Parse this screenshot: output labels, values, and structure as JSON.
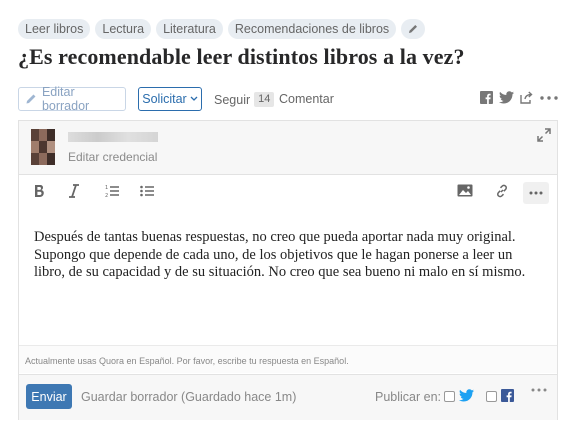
{
  "topics": [
    "Leer libros",
    "Lectura",
    "Literatura",
    "Recomendaciones de libros"
  ],
  "question": {
    "title": "¿Es recomendable leer distintos libros a la vez?"
  },
  "actions": {
    "edit_draft": "Editar borrador",
    "request": "Solicitar",
    "follow": "Seguir",
    "follow_count": "14",
    "comment": "Comentar"
  },
  "editor": {
    "edit_credential": "Editar credencial",
    "answer_text": "Después de tantas buenas respuestas, no creo que pueda aportar nada muy original. Supongo que depende de cada uno, de los objetivos que le hagan ponerse a leer un libro, de su capacidad y de su situación. No creo que sea bueno ni malo en sí mismo.",
    "language_hint": "Actualmente usas Quora en Español. Por favor, escribe tu respuesta en Español."
  },
  "footer": {
    "send": "Enviar",
    "save_draft": "Guardar borrador (Guardado hace 1m)",
    "publish_label": "Publicar en:"
  },
  "colors": {
    "accent": "#2b6dad",
    "send_button": "#3e78b3",
    "twitter": "#1da1f2",
    "facebook": "#3b5998"
  },
  "icons": [
    "pencil-icon",
    "chevron-down-icon",
    "facebook-icon",
    "twitter-icon",
    "share-icon",
    "more-icon",
    "expand-icon",
    "bold-icon",
    "italic-icon",
    "ordered-list-icon",
    "bullet-list-icon",
    "image-icon",
    "link-icon"
  ]
}
